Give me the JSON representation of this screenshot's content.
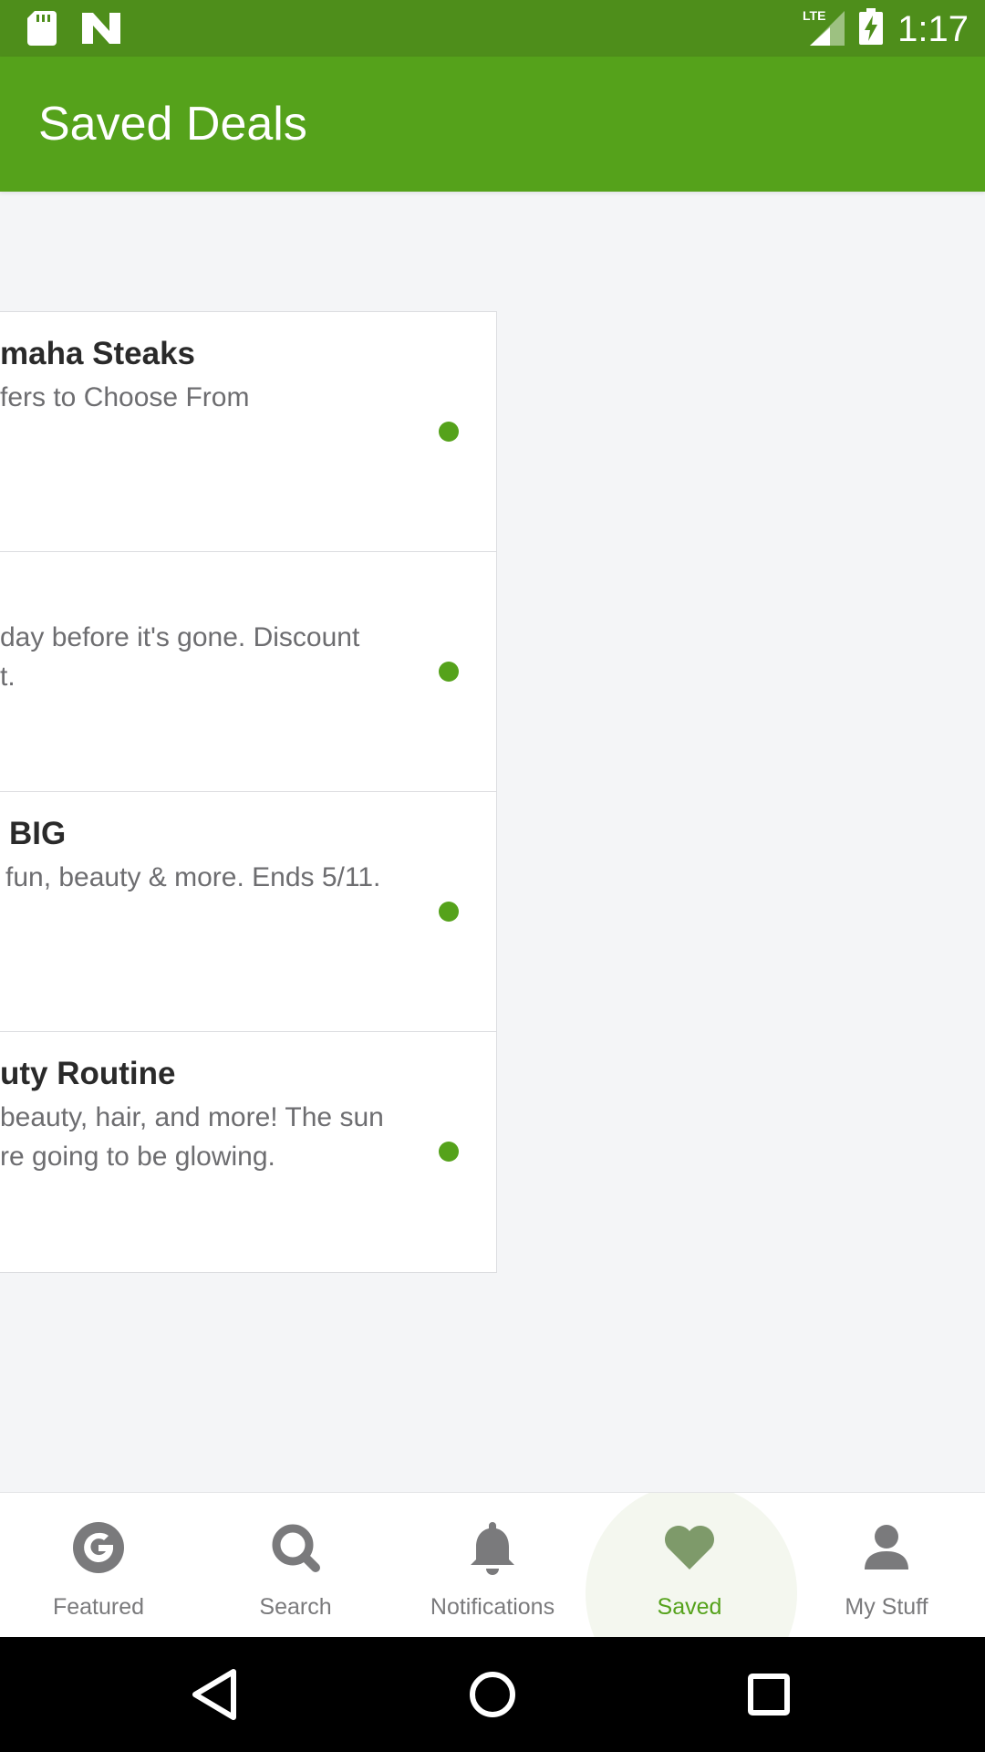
{
  "status_bar": {
    "time": "1:17",
    "network": "LTE",
    "icons": [
      "sd-card-icon",
      "n-logo-icon",
      "signal-icon",
      "battery-charging-icon"
    ]
  },
  "app_bar": {
    "title": "Saved Deals"
  },
  "deals": [
    {
      "title": "maha Steaks",
      "description_lines": [
        "fers to Choose From"
      ]
    },
    {
      "title": "",
      "description_lines": [
        "day before it's gone. Discount",
        "t."
      ]
    },
    {
      "title": "BIG",
      "description_lines": [
        "fun, beauty & more. Ends 5/11."
      ]
    },
    {
      "title": "uty Routine",
      "description_lines": [
        "beauty, hair, and more! The sun",
        "re going to be glowing."
      ]
    }
  ],
  "bottom_nav": {
    "items": [
      {
        "label": "Featured",
        "icon": "groupon-g-icon"
      },
      {
        "label": "Search",
        "icon": "search-icon"
      },
      {
        "label": "Notifications",
        "icon": "bell-icon"
      },
      {
        "label": "Saved",
        "icon": "heart-icon",
        "active": true
      },
      {
        "label": "My Stuff",
        "icon": "person-icon"
      }
    ]
  },
  "colors": {
    "status_bar": "#4e8e1b",
    "app_bar": "#55a21b",
    "accent": "#55a21b",
    "background": "#f4f5f7",
    "nav_inactive": "#7a7a7c"
  }
}
